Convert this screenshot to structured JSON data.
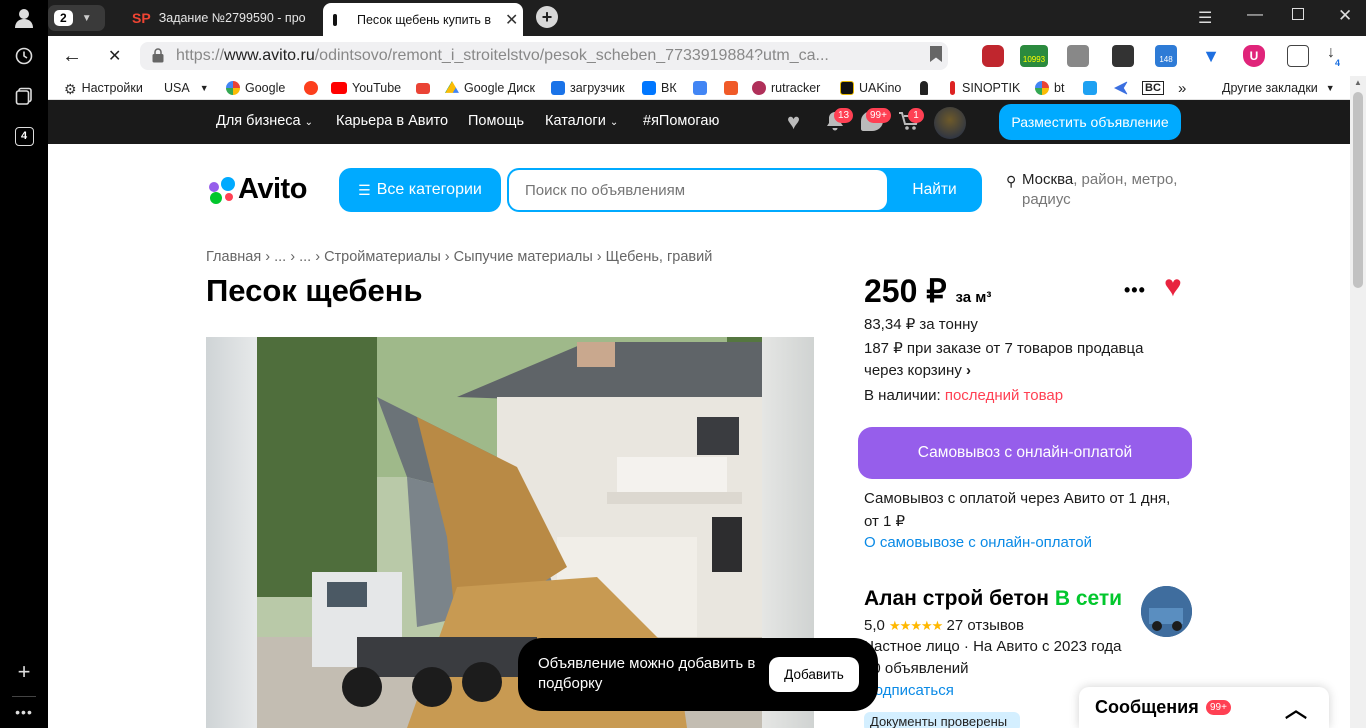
{
  "browser": {
    "tab_count_badge": "2",
    "tabs": [
      {
        "label": "Задание №2799590 - про",
        "icon": "sp-icon"
      },
      {
        "label": "Песок щебень купить в",
        "icon": "avito-tab-icon"
      }
    ],
    "url_prefix": "https://",
    "url_domain": "www.avito.ru",
    "url_path": "/odintsovo/remont_i_stroitelstvo/pesok_scheben_7733919884?utm_ca...",
    "sidebar_badge": "4",
    "ext_badge": "10993",
    "ext_badge2": "148",
    "download_badge": "4"
  },
  "bookmarks": {
    "items": [
      "Настройки",
      "USA",
      "Google",
      "YouTube",
      "Google Диск",
      "загрузчик",
      "ВК",
      "rutracker",
      "UAKino",
      "SINOPTIK",
      "bt",
      "BC"
    ],
    "more": "»",
    "other": "Другие закладки"
  },
  "topbar": {
    "business": "Для бизнеса",
    "career": "Карьера в Авито",
    "help": "Помощь",
    "catalogs": "Каталоги",
    "help_tag": "#яПомогаю",
    "notif_count": "13",
    "msg_count": "99+",
    "cart_count": "1",
    "post_ad": "Разместить объявление"
  },
  "header": {
    "logo": "Avito",
    "all_categories": "Все категории",
    "search_placeholder": "Поиск по объявлениям",
    "search_button": "Найти",
    "location_city": "Москва",
    "location_rest": ", район, метро, радиус"
  },
  "listing": {
    "breadcrumbs": [
      "Главная",
      "...",
      "...",
      "Стройматериалы",
      "Сыпучие материалы",
      "Щебень, гравий"
    ],
    "title": "Песок щебень",
    "price": "250 ₽",
    "price_unit": "за м³",
    "price_per_ton": "83,34 ₽ за тонну",
    "bulk_price_line1": "187 ₽ при заказе от 7 товаров продавца",
    "bulk_price_line2": "через корзину",
    "stock_label": "В наличии:",
    "stock_value": "последний товар",
    "buy_button": "Самовывоз с онлайн-оплатой",
    "pickup_line1": "Самовывоз с оплатой через Авито от 1 дня,",
    "pickup_line2": "от 1 ₽",
    "pickup_link": "О самовывозе с онлайн-оплатой"
  },
  "seller": {
    "name": "Алан строй бетон",
    "online": "В сети",
    "rating": "5,0",
    "reviews": "27 отзывов",
    "type": "Частное лицо · На Авито с 2023 года",
    "ads": "10 объявлений",
    "subscribe": "Подписаться",
    "verified": "Документы проверены"
  },
  "toast": {
    "text": "Объявление можно добавить в подборку",
    "button": "Добавить"
  },
  "messages": {
    "label": "Сообщения",
    "count": "99+"
  },
  "colors": {
    "avito_blue": "#00aaff",
    "purple": "#965eeb",
    "red": "#ff4053",
    "green": "#02c72d"
  }
}
